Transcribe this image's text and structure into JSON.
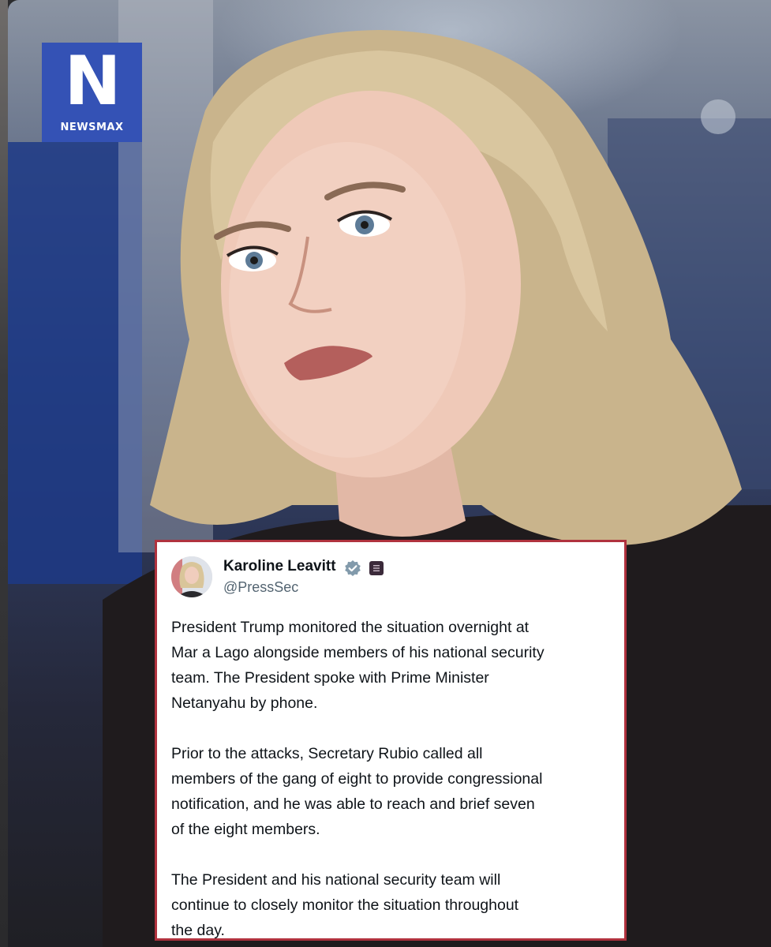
{
  "logo": {
    "letter": "N",
    "wordmark": "NEWSMAX",
    "color": "#3452b5",
    "accent": "#d32f3a"
  },
  "photo": {
    "subject": "woman-portrait",
    "background_color": "#2d3757"
  },
  "tweet": {
    "author_name": "Karoline Leavitt",
    "handle": "@PressSec",
    "verified_icon": "verified-badge-icon",
    "affiliation_icon": "government-affiliation-icon",
    "paragraphs": [
      "President Trump monitored the situation overnight at\nMar a Lago alongside members of his national security\nteam. The President spoke with Prime Minister\nNetanyahu by phone.",
      "Prior to the attacks, Secretary Rubio called all\nmembers of the gang of eight to provide congressional\nnotification, and he was able to reach and brief seven\nof the eight members.",
      "The President and his national security team will\ncontinue to closely monitor the situation throughout\nthe day."
    ],
    "border_color": "#b0323e"
  }
}
